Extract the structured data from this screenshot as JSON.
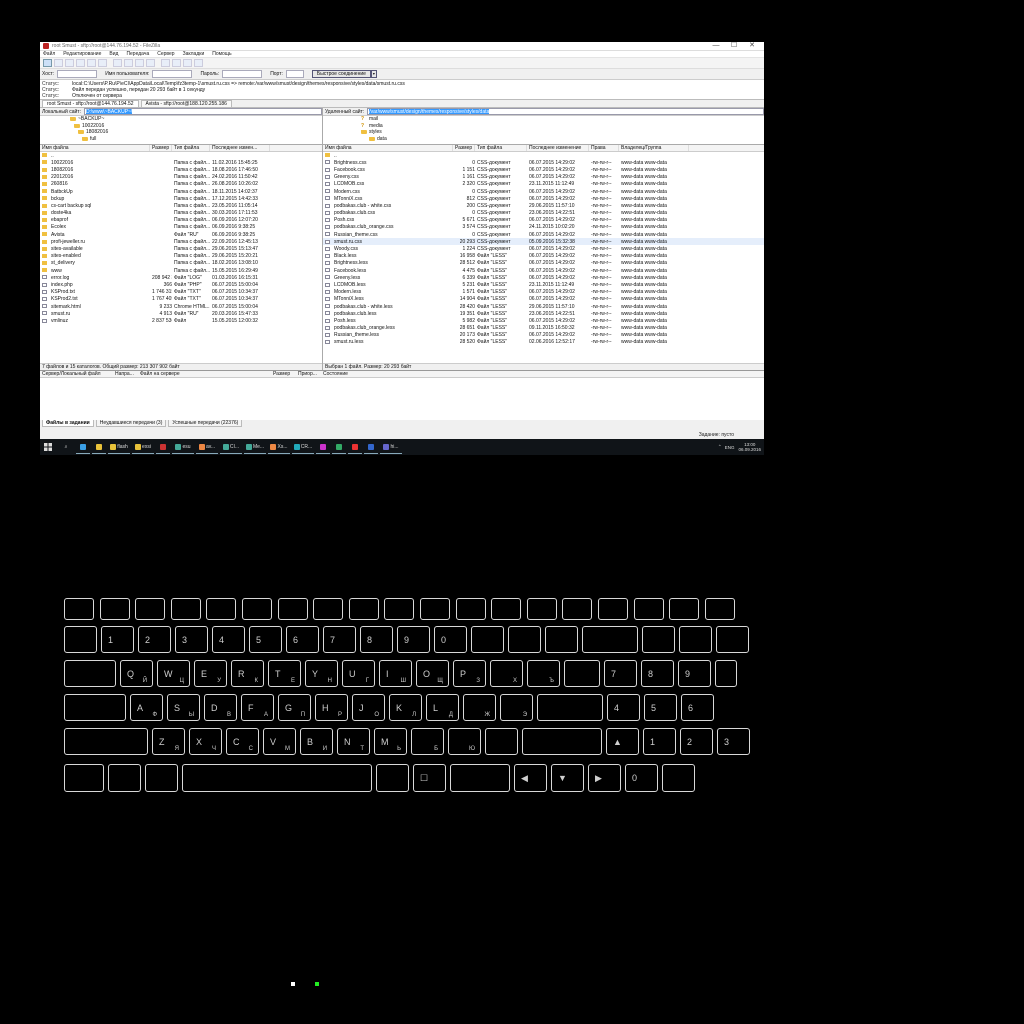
{
  "window": {
    "title": "root Smust - sftp://root@144.76.194.52 - FileZilla",
    "minimize": "—",
    "maximize": "☐",
    "close": "✕"
  },
  "menu": [
    "Файл",
    "Редактирование",
    "Вид",
    "Передача",
    "Сервер",
    "Закладки",
    "Помощь"
  ],
  "toolbar_icons": [
    "site-manager-icon",
    "toggle-log-icon",
    "toggle-tree-icon",
    "toggle-remote-tree-icon",
    "toggle-queue-icon",
    "refresh-icon",
    "process-queue-icon",
    "cancel-icon",
    "disconnect-icon",
    "reconnect-icon",
    "filter-icon",
    "compare-icon",
    "sync-browse-icon",
    "search-icon"
  ],
  "quickconnect": {
    "host_label": "Хост:",
    "user_label": "Имя пользователя:",
    "pass_label": "Пароль:",
    "port_label": "Порт:",
    "button": "Быстрое соединение",
    "dropdown": "▾",
    "host": "",
    "user": "",
    "pass": "",
    "port": ""
  },
  "log": [
    {
      "k": "Статус:",
      "v": "local:C:\\Users\\P.Ru\\P\\eCI\\AppData\\Local\\Temp\\fz3temp-1\\smust.ru.css => remote:/var/www/smust/design/themes/responsive/styles/data/smust.ru.css"
    },
    {
      "k": "Статус:",
      "v": "Файл передан успешно, передан 20 293 байт в 1 секунду"
    },
    {
      "k": "Статус:",
      "v": "Отключен от сервера"
    }
  ],
  "tabs": [
    "root Smust - sftp://root@144.76.194.52",
    "Avista - sftp://root@188.120.255.186"
  ],
  "local": {
    "path_label": "Локальный сайт:",
    "path": "D:\\www\\~BACKUP~\\",
    "tree": [
      "~BACKUP~",
      "10022016",
      "18082016",
      "full"
    ],
    "headers": [
      "Имя файла",
      "Размер",
      "Тип файла",
      "Последнее измен..."
    ],
    "rows": [
      {
        "n": "..",
        "s": "",
        "t": "",
        "d": "",
        "dir": true
      },
      {
        "n": "10022016",
        "s": "",
        "t": "Папка с файл...",
        "d": "11.02.2016 15:45:25",
        "dir": true
      },
      {
        "n": "18082016",
        "s": "",
        "t": "Папка с файл...",
        "d": "18.08.2016 17:46:50",
        "dir": true
      },
      {
        "n": "22012016",
        "s": "",
        "t": "Папка с файл...",
        "d": "24.02.2016 11:50:42",
        "dir": true
      },
      {
        "n": "260816",
        "s": "",
        "t": "Папка с файл...",
        "d": "26.08.2016 10:26:02",
        "dir": true
      },
      {
        "n": "BatbckUp",
        "s": "",
        "t": "Папка с файл...",
        "d": "18.11.2015 14:02:37",
        "dir": true
      },
      {
        "n": "bckup",
        "s": "",
        "t": "Папка с файл...",
        "d": "17.12.2015 14:42:33",
        "dir": true
      },
      {
        "n": "cs-cart backup sql",
        "s": "",
        "t": "Папка с файл...",
        "d": "23.05.2016 11:05:14",
        "dir": true
      },
      {
        "n": "doste4ka",
        "s": "",
        "t": "Папка с файл...",
        "d": "30.03.2016 17:11:53",
        "dir": true
      },
      {
        "n": "ebaprof",
        "s": "",
        "t": "Папка с файл...",
        "d": "06.09.2016 12:07:20",
        "dir": true
      },
      {
        "n": "Ecolex",
        "s": "",
        "t": "Папка с файл...",
        "d": "06.09.2016 9:38:25",
        "dir": true
      },
      {
        "n": "Avista",
        "s": "",
        "t": "Файл \"RU\"",
        "d": "06.09.2016 9:38:25",
        "dir": true
      },
      {
        "n": "profi-jeweller.ru",
        "s": "",
        "t": "Папка с файл...",
        "d": "22.09.2016 12:45:13",
        "dir": true
      },
      {
        "n": "sites-available",
        "s": "",
        "t": "Папка с файл...",
        "d": "29.06.2015 15:13:47",
        "dir": true
      },
      {
        "n": "sites-enabled",
        "s": "",
        "t": "Папка с файл...",
        "d": "29.06.2015 15:20:21",
        "dir": true
      },
      {
        "n": "st_delivery",
        "s": "",
        "t": "Папка с файл...",
        "d": "18.02.2016 13:08:10",
        "dir": true
      },
      {
        "n": "www",
        "s": "",
        "t": "Папка с файл...",
        "d": "15.05.2015 16:29:49",
        "dir": true
      },
      {
        "n": "error.log",
        "s": "208 942 334",
        "t": "Файл \"LOG\"",
        "d": "01.03.2016 16:15:31",
        "dir": false
      },
      {
        "n": "index.php",
        "s": "366",
        "t": "Файл \"PHP\"",
        "d": "06.07.2015 15:00:04",
        "dir": false
      },
      {
        "n": "KSProd.txt",
        "s": "1 746 315",
        "t": "Файл \"TXT\"",
        "d": "06.07.2015 10:34:37",
        "dir": false
      },
      {
        "n": "KSProd2.txt",
        "s": "1 767 405",
        "t": "Файл \"TXT\"",
        "d": "06.07.2015 10:34:37",
        "dir": false
      },
      {
        "n": "sitemark.html",
        "s": "9 233",
        "t": "Chrome HTML...",
        "d": "06.07.2015 15:00:04",
        "dir": false
      },
      {
        "n": "smust.ru",
        "s": "4 913",
        "t": "Файл \"RU\"",
        "d": "20.03.2016 15:47:33",
        "dir": false
      },
      {
        "n": "vmlinuz",
        "s": "2 837 536",
        "t": "Файл",
        "d": "15.05.2015 12:00:32",
        "dir": false
      }
    ],
    "status": "7 файлов и 15 каталогов. Общий размер: 213 307 902 байт"
  },
  "remote": {
    "path_label": "Удаленный сайт:",
    "path": "/var/www/smust/design/themes/responsive/styles/data",
    "tree": [
      {
        "n": "mail",
        "q": true
      },
      {
        "n": "media",
        "q": true
      },
      {
        "n": "styles",
        "q": false
      },
      {
        "n": "data",
        "q": false
      }
    ],
    "headers": [
      "Имя файла",
      "Размер",
      "Тип файла",
      "Последнее изменение",
      "Права",
      "Владелец/Группа"
    ],
    "rows": [
      {
        "n": "..",
        "s": "",
        "t": "",
        "d": "",
        "p": "",
        "o": ""
      },
      {
        "n": "Brightness.css",
        "s": "0",
        "t": "CSS-документ",
        "d": "06.07.2015 14:29:02",
        "p": "-rw-rw-r--",
        "o": "www-data www-data"
      },
      {
        "n": "Facebook.css",
        "s": "1 151",
        "t": "CSS-документ",
        "d": "06.07.2015 14:29:02",
        "p": "-rw-rw-r--",
        "o": "www-data www-data"
      },
      {
        "n": "Greeny.css",
        "s": "1 161",
        "t": "CSS-документ",
        "d": "06.07.2015 14:29:02",
        "p": "-rw-rw-r--",
        "o": "www-data www-data"
      },
      {
        "n": "LCDMOB.css",
        "s": "2 320",
        "t": "CSS-документ",
        "d": "23.11.2015 11:12:49",
        "p": "-rw-rw-r--",
        "o": "www-data www-data"
      },
      {
        "n": "Modern.css",
        "s": "0",
        "t": "CSS-документ",
        "d": "06.07.2015 14:29:02",
        "p": "-rw-rw-r--",
        "o": "www-data www-data"
      },
      {
        "n": "MTonniX.css",
        "s": "812",
        "t": "CSS-документ",
        "d": "06.07.2015 14:29:02",
        "p": "-rw-rw-r--",
        "o": "www-data www-data"
      },
      {
        "n": "podbakas.club - white.css",
        "s": "200",
        "t": "CSS-документ",
        "d": "29.06.2015 11:57:10",
        "p": "-rw-rw-r--",
        "o": "www-data www-data"
      },
      {
        "n": "podbakas.club.css",
        "s": "0",
        "t": "CSS-документ",
        "d": "23.06.2015 14:22:51",
        "p": "-rw-rw-r--",
        "o": "www-data www-data"
      },
      {
        "n": "Posh.css",
        "s": "5 671",
        "t": "CSS-документ",
        "d": "06.07.2015 14:29:02",
        "p": "-rw-rw-r--",
        "o": "www-data www-data"
      },
      {
        "n": "podbakas.club_orange.css",
        "s": "3 574",
        "t": "CSS-документ",
        "d": "24.11.2015 10:02:20",
        "p": "-rw-rw-r--",
        "o": "www-data www-data"
      },
      {
        "n": "Russian_theme.css",
        "s": "0",
        "t": "CSS-документ",
        "d": "06.07.2015 14:29:02",
        "p": "-rw-rw-r--",
        "o": "www-data www-data"
      },
      {
        "n": "smust.ru.css",
        "s": "20 293",
        "t": "CSS-документ",
        "d": "05.09.2016 15:32:38",
        "p": "-rw-rw-r--",
        "o": "www-data www-data",
        "sel": true
      },
      {
        "n": "Woody.css",
        "s": "1 224",
        "t": "CSS-документ",
        "d": "06.07.2015 14:29:02",
        "p": "-rw-rw-r--",
        "o": "www-data www-data"
      },
      {
        "n": "Black.less",
        "s": "16 958",
        "t": "Файл \"LESS\"",
        "d": "06.07.2015 14:29:02",
        "p": "-rw-rw-r--",
        "o": "www-data www-data"
      },
      {
        "n": "Brightness.less",
        "s": "28 512",
        "t": "Файл \"LESS\"",
        "d": "06.07.2015 14:29:02",
        "p": "-rw-rw-r--",
        "o": "www-data www-data"
      },
      {
        "n": "Facebook.less",
        "s": "4 475",
        "t": "Файл \"LESS\"",
        "d": "06.07.2015 14:29:02",
        "p": "-rw-rw-r--",
        "o": "www-data www-data"
      },
      {
        "n": "Greeny.less",
        "s": "6 339",
        "t": "Файл \"LESS\"",
        "d": "06.07.2015 14:29:02",
        "p": "-rw-rw-r--",
        "o": "www-data www-data"
      },
      {
        "n": "LCDMOB.less",
        "s": "5 231",
        "t": "Файл \"LESS\"",
        "d": "23.11.2015 11:12:49",
        "p": "-rw-rw-r--",
        "o": "www-data www-data"
      },
      {
        "n": "Modern.less",
        "s": "1 571",
        "t": "Файл \"LESS\"",
        "d": "06.07.2015 14:29:02",
        "p": "-rw-rw-r--",
        "o": "www-data www-data"
      },
      {
        "n": "MTonniX.less",
        "s": "14 904",
        "t": "Файл \"LESS\"",
        "d": "06.07.2015 14:29:02",
        "p": "-rw-rw-r--",
        "o": "www-data www-data"
      },
      {
        "n": "podbakas.club - white.less",
        "s": "28 420",
        "t": "Файл \"LESS\"",
        "d": "29.06.2015 11:57:10",
        "p": "-rw-rw-r--",
        "o": "www-data www-data"
      },
      {
        "n": "podbakas.club.less",
        "s": "19 351",
        "t": "Файл \"LESS\"",
        "d": "23.06.2015 14:22:51",
        "p": "-rw-rw-r--",
        "o": "www-data www-data"
      },
      {
        "n": "Posh.less",
        "s": "5 982",
        "t": "Файл \"LESS\"",
        "d": "06.07.2015 14:29:02",
        "p": "-rw-rw-r--",
        "o": "www-data www-data"
      },
      {
        "n": "podbakas.club_orange.less",
        "s": "28 651",
        "t": "Файл \"LESS\"",
        "d": "09.11.2015 16:50:32",
        "p": "-rw-rw-r--",
        "o": "www-data www-data"
      },
      {
        "n": "Russian_theme.less",
        "s": "20 173",
        "t": "Файл \"LESS\"",
        "d": "06.07.2015 14:29:02",
        "p": "-rw-rw-r--",
        "o": "www-data www-data"
      },
      {
        "n": "smust.ru.less",
        "s": "28 520",
        "t": "Файл \"LESS\"",
        "d": "02.06.2016 12:52:17",
        "p": "-rw-rw-r--",
        "o": "www-data www-data"
      }
    ],
    "status": "Выбран 1 файл. Размер: 20 293 байт"
  },
  "queue": {
    "headers": [
      "Сервер/Локальный файл",
      "Напра...",
      "Файл на сервере",
      "Размер",
      "Приор...",
      "Состояние"
    ],
    "tabs": [
      "Файлы в задании",
      "Неудавшиеся передачи (3)",
      "Успешные передачи (22376)"
    ],
    "status": "Задание: пусто"
  },
  "taskbar": {
    "search_icon": "⌕",
    "apps": [
      {
        "label": "",
        "color": "#3aa0e8"
      },
      {
        "label": "",
        "color": "#e8c23a"
      },
      {
        "label": "flash",
        "color": "#e8c23a"
      },
      {
        "label": "exsi",
        "color": "#e8c23a"
      },
      {
        "label": "",
        "color": "#c33"
      },
      {
        "label": "esu",
        "color": "#4a9"
      },
      {
        "label": "av...",
        "color": "#e84"
      },
      {
        "label": "CI...",
        "color": "#4a9"
      },
      {
        "label": "Me...",
        "color": "#4a9"
      },
      {
        "label": "Xs...",
        "color": "#e84"
      },
      {
        "label": "CR...",
        "color": "#2ab"
      },
      {
        "label": "",
        "color": "#c3c"
      },
      {
        "label": "",
        "color": "#3a6"
      },
      {
        "label": "",
        "color": "#e33"
      },
      {
        "label": "",
        "color": "#36c"
      },
      {
        "label": "hi...",
        "color": "#66c"
      }
    ],
    "tray": [
      "⌃",
      "ENG"
    ],
    "time": "13:00",
    "date": "06.09.2016"
  },
  "keyboard": {
    "colors": {
      "lines": "#d8d8d8",
      "led_white": "#ffffff",
      "led_green": "#22ee22"
    },
    "rows": [
      [
        {
          "m": "",
          "s": ""
        },
        {
          "m": "",
          "s": ""
        },
        {
          "m": "",
          "s": ""
        },
        {
          "m": "",
          "s": ""
        },
        {
          "m": "",
          "s": ""
        },
        {
          "m": "",
          "s": ""
        },
        {
          "m": "",
          "s": ""
        },
        {
          "m": "",
          "s": ""
        },
        {
          "m": "",
          "s": ""
        },
        {
          "m": "",
          "s": ""
        },
        {
          "m": "",
          "s": ""
        },
        {
          "m": "",
          "s": ""
        },
        {
          "m": "",
          "s": ""
        },
        {
          "m": "",
          "s": ""
        },
        {
          "m": "",
          "s": ""
        },
        {
          "m": "",
          "s": ""
        },
        {
          "m": "",
          "s": ""
        },
        {
          "m": "",
          "s": ""
        },
        {
          "m": "",
          "s": ""
        },
        {
          "m": "",
          "s": ""
        }
      ],
      [
        {
          "m": "",
          "s": ""
        },
        {
          "m": "1",
          "s": ""
        },
        {
          "m": "2",
          "s": ""
        },
        {
          "m": "3",
          "s": ""
        },
        {
          "m": "4",
          "s": ""
        },
        {
          "m": "5",
          "s": ""
        },
        {
          "m": "6",
          "s": ""
        },
        {
          "m": "7",
          "s": ""
        },
        {
          "m": "8",
          "s": ""
        },
        {
          "m": "9",
          "s": ""
        },
        {
          "m": "0",
          "s": ""
        },
        {
          "m": "",
          "s": ""
        },
        {
          "m": "",
          "s": ""
        },
        {
          "m": "",
          "s": ""
        },
        {
          "m": "",
          "s": ""
        },
        {
          "m": "",
          "s": ""
        },
        {
          "m": "",
          "s": ""
        },
        {
          "m": "",
          "s": ""
        }
      ],
      [
        {
          "m": "",
          "s": ""
        },
        {
          "m": "Q",
          "s": "Й"
        },
        {
          "m": "W",
          "s": "Ц"
        },
        {
          "m": "E",
          "s": "У"
        },
        {
          "m": "R",
          "s": "К"
        },
        {
          "m": "T",
          "s": "Е"
        },
        {
          "m": "Y",
          "s": "Н"
        },
        {
          "m": "U",
          "s": "Г"
        },
        {
          "m": "I",
          "s": "Ш"
        },
        {
          "m": "O",
          "s": "Щ"
        },
        {
          "m": "P",
          "s": "З"
        },
        {
          "m": "",
          "s": "Х"
        },
        {
          "m": "",
          "s": "Ъ"
        },
        {
          "m": "",
          "s": ""
        },
        {
          "m": "7",
          "s": ""
        },
        {
          "m": "8",
          "s": ""
        },
        {
          "m": "9",
          "s": ""
        },
        {
          "m": "",
          "s": ""
        }
      ],
      [
        {
          "m": "",
          "s": ""
        },
        {
          "m": "A",
          "s": "Ф"
        },
        {
          "m": "S",
          "s": "Ы"
        },
        {
          "m": "D",
          "s": "В"
        },
        {
          "m": "F",
          "s": "А"
        },
        {
          "m": "G",
          "s": "П"
        },
        {
          "m": "H",
          "s": "Р"
        },
        {
          "m": "J",
          "s": "О"
        },
        {
          "m": "K",
          "s": "Л"
        },
        {
          "m": "L",
          "s": "Д"
        },
        {
          "m": "",
          "s": "Ж"
        },
        {
          "m": "",
          "s": "Э"
        },
        {
          "m": "",
          "s": ""
        },
        {
          "m": "4",
          "s": ""
        },
        {
          "m": "5",
          "s": ""
        },
        {
          "m": "6",
          "s": ""
        }
      ],
      [
        {
          "m": "",
          "s": ""
        },
        {
          "m": "Z",
          "s": "Я"
        },
        {
          "m": "X",
          "s": "Ч"
        },
        {
          "m": "C",
          "s": "С"
        },
        {
          "m": "V",
          "s": "М"
        },
        {
          "m": "B",
          "s": "И"
        },
        {
          "m": "N",
          "s": "Т"
        },
        {
          "m": "M",
          "s": "Ь"
        },
        {
          "m": "",
          "s": "Б"
        },
        {
          "m": "",
          "s": "Ю"
        },
        {
          "m": "",
          "s": ""
        },
        {
          "m": "",
          "s": ""
        },
        {
          "m": "▲",
          "s": ""
        },
        {
          "m": "1",
          "s": ""
        },
        {
          "m": "2",
          "s": ""
        },
        {
          "m": "3",
          "s": ""
        }
      ],
      [
        {
          "m": "",
          "s": ""
        },
        {
          "m": "",
          "s": ""
        },
        {
          "m": "",
          "s": ""
        },
        {
          "m": "",
          "s": ""
        },
        {
          "m": "",
          "s": ""
        },
        {
          "m": "☐",
          "s": ""
        },
        {
          "m": "",
          "s": ""
        },
        {
          "m": "◀",
          "s": ""
        },
        {
          "m": "▼",
          "s": ""
        },
        {
          "m": "▶",
          "s": ""
        },
        {
          "m": "0",
          "s": ""
        },
        {
          "m": "",
          "s": ""
        }
      ]
    ]
  }
}
